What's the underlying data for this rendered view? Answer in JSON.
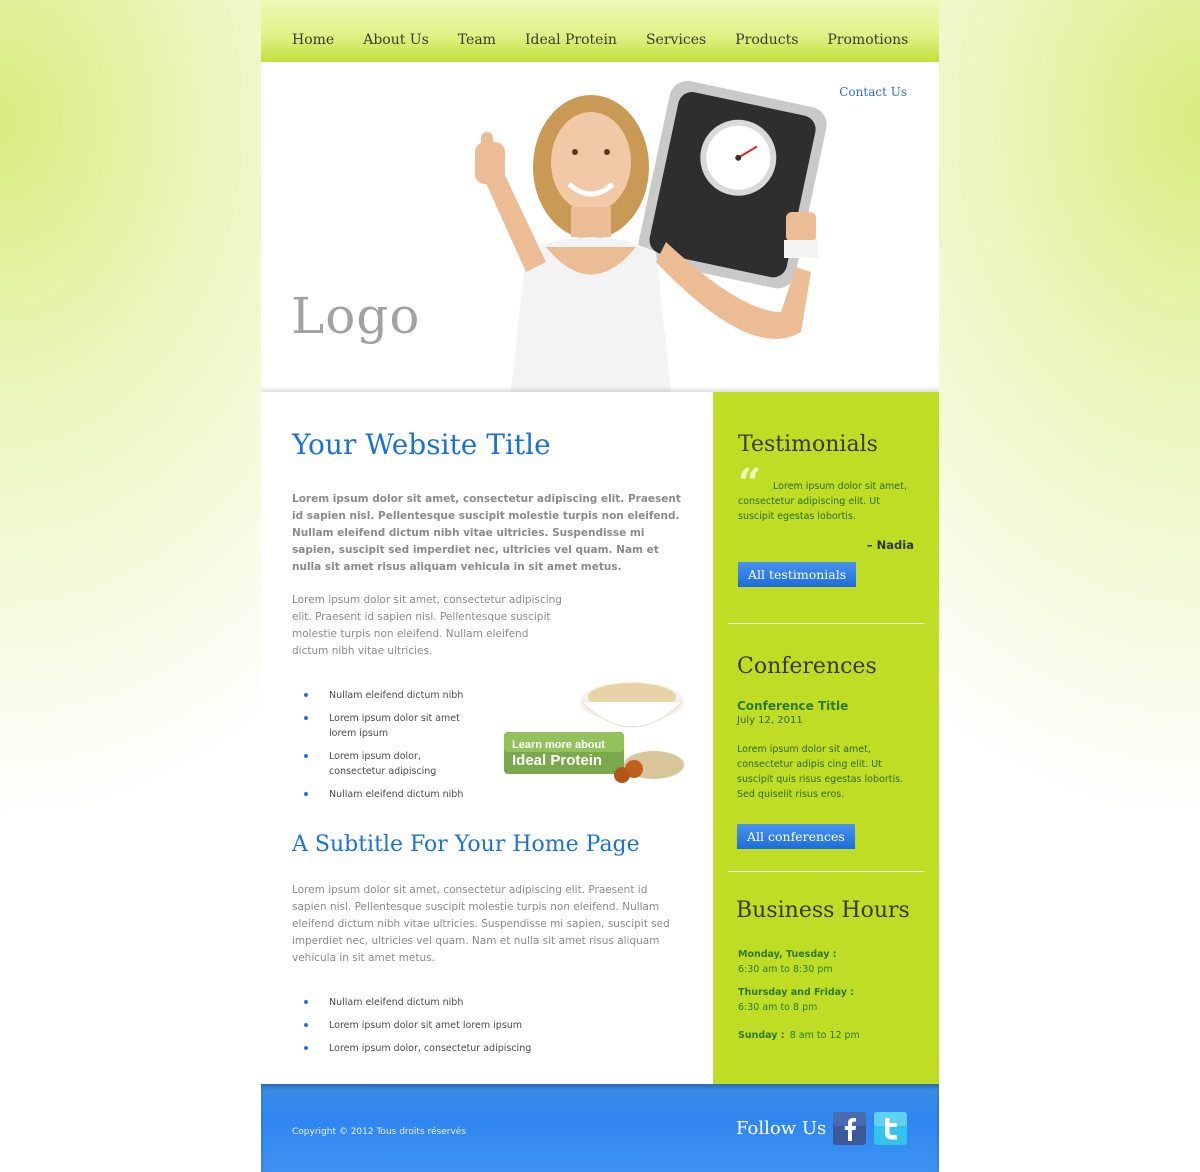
{
  "nav": {
    "items": [
      "Home",
      "About Us",
      "Team",
      "Ideal Protein",
      "Services",
      "Products",
      "Promotions"
    ]
  },
  "header": {
    "contact_label": "Contact Us",
    "logo_text": "Logo"
  },
  "main": {
    "title": "Your Website Title",
    "lead": "Lorem ipsum dolor sit amet, consectetur adipiscing elit. Praesent id sapien nisl. Pellentesque suscipit molestie turpis non eleifend. Nullam eleifend dictum nibh vitae ultricies. Suspendisse mi sapien, suscipit sed imperdiet nec, ultricies vel quam. Nam et nulla sit amet risus aliquam vehicula in sit amet metus.",
    "para1": "Lorem ipsum dolor sit amet, consectetur adipiscing elit. Praesent id sapien nisl. Pellentesque suscipit molestie turpis non eleifend. Nullam eleifend dictum nibh vitae ultricies.",
    "bullets1": [
      "Nullam eleifend dictum nibh",
      "Lorem ipsum dolor sit amet lorem ipsum",
      "Lorem ipsum dolor, consectetur adipiscing",
      "Nullam eleifend dictum nibh"
    ],
    "promo": {
      "line1": "Learn more about",
      "line2": "Ideal Protein"
    },
    "subtitle": "A Subtitle For Your Home Page",
    "para2": "Lorem ipsum dolor sit amet, consectetur adipiscing elit. Praesent id sapien nisl. Pellentesque suscipit molestie turpis non eleifend. Nullam eleifend dictum nibh vitae ultricies. Suspendisse mi sapien, suscipit sed imperdiet nec, ultricies vel quam. Nam et nulla sit amet risus aliquam vehicula in sit amet metus.",
    "bullets2": [
      "Nullam eleifend dictum nibh",
      "Lorem ipsum dolor sit amet lorem ipsum",
      "Lorem ipsum dolor, consectetur adipiscing"
    ]
  },
  "sidebar": {
    "testimonials": {
      "heading": "Testimonials",
      "quote": "Lorem ipsum dolor sit amet, consectetur adipiscing elit. Ut suscipit egestas lobortis.",
      "author": "– Nadia",
      "button": "All testimonials"
    },
    "conferences": {
      "heading": "Conferences",
      "title": "Conference Title",
      "date": "July 12, 2011",
      "text": "Lorem ipsum dolor sit amet, consectetur adipis cing elit. Ut suscipit quis risus egestas lobortis. Sed quiselit risus eros.",
      "button": "All conferences"
    },
    "hours": {
      "heading": "Business Hours",
      "rows": [
        {
          "label": "Monday, Tuesday :",
          "value": "6:30 am to 8:30 pm"
        },
        {
          "label": "Thursday and Friday :",
          "value": "6:30 am to 8 pm"
        },
        {
          "label": "Sunday :",
          "value": "8 am to 12 pm"
        }
      ]
    }
  },
  "footer": {
    "copyright": "Copyright © 2012 Tous droits réservés",
    "follow": "Follow Us",
    "icons": [
      "facebook-icon",
      "twitter-icon"
    ]
  },
  "colors": {
    "accent_green": "#bedd24",
    "title_blue": "#1b71d8",
    "footer_blue": "#2f86ef",
    "button_blue": "#1c6ddb"
  }
}
